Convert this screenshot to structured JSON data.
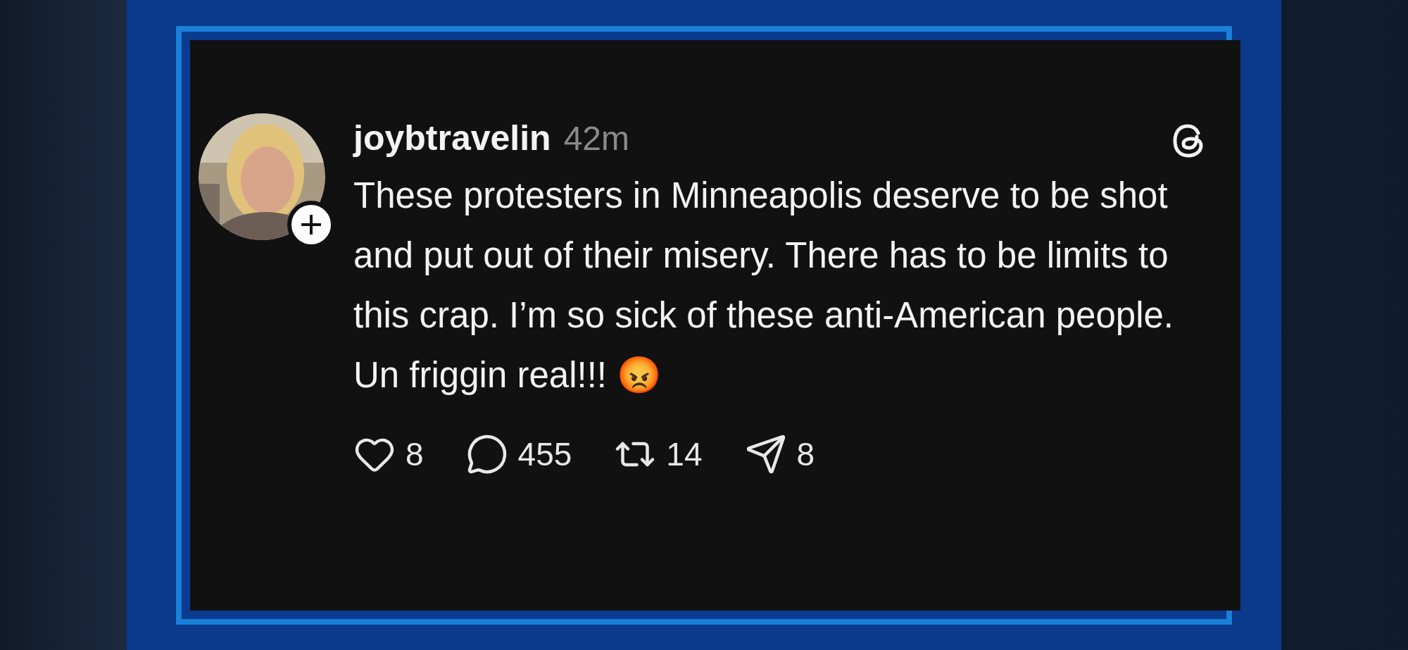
{
  "post": {
    "username": "joybtravelin",
    "time": "42m",
    "text": "These protesters in Minneapolis deserve to be shot and put out of their misery. There has to be limits to this crap. I’m so sick of these anti-American people. Un friggin real!!! 😡",
    "actions": [
      {
        "kind": "like",
        "count": "8"
      },
      {
        "kind": "reply",
        "count": "455"
      },
      {
        "kind": "repost",
        "count": "14"
      },
      {
        "kind": "share",
        "count": "8"
      }
    ]
  }
}
